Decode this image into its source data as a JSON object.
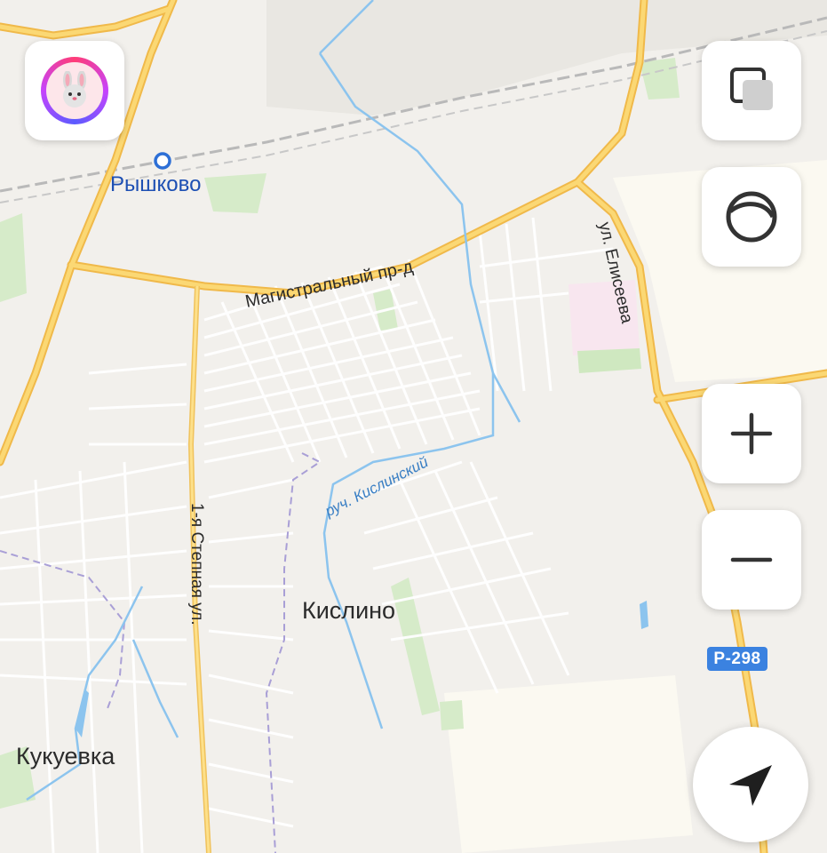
{
  "map": {
    "places": {
      "station": "Рышково",
      "district_main": "Кислино",
      "district_left": "Кукуевка"
    },
    "streets": {
      "magistralny": "Магистральный пр-д",
      "eliseeva": "ул. Елисеева",
      "stepnaya": "1-я Степная ул.",
      "creek": "руч. Кислинский"
    },
    "route_shield": "Р-298",
    "colors": {
      "background": "#f2f0ec",
      "major_road": "#f7c95e",
      "minor_road": "#ffffff",
      "water": "#8cc4ee",
      "park": "#cfe8c0",
      "station_blue": "#2d6fd6",
      "route_shield": "#3b82e0"
    }
  },
  "controls": {
    "profile_icon": "bunny-avatar-icon",
    "layers_icon": "layers-icon",
    "compass_icon": "compass-icon",
    "zoom_in_icon": "plus-icon",
    "zoom_out_icon": "minus-icon",
    "locate_icon": "navigation-arrow-icon"
  }
}
